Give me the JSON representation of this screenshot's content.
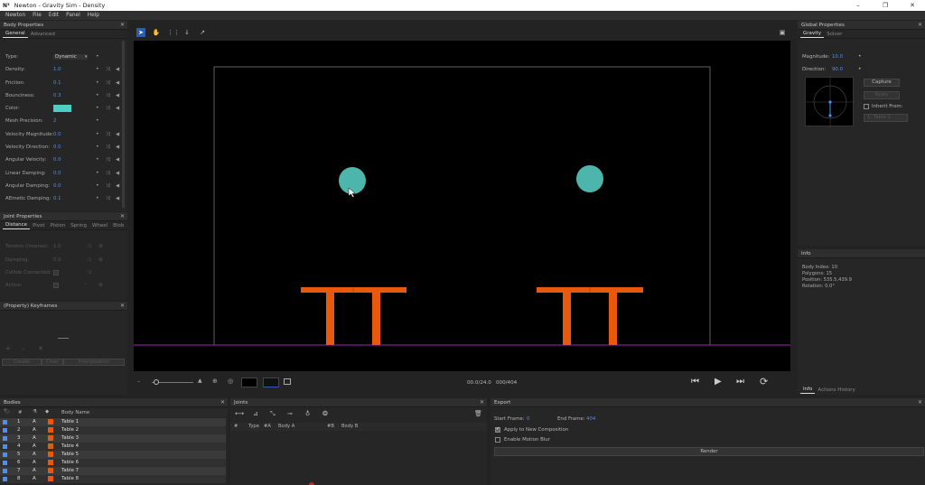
{
  "window": {
    "title": "Newton - Gravity Sim - Density",
    "logo": "N³"
  },
  "menu": [
    "Newton",
    "File",
    "Edit",
    "Panel",
    "Help"
  ],
  "body_properties": {
    "title": "Body Properties",
    "tabs": [
      "General",
      "Advanced"
    ],
    "rows": [
      {
        "label": "Type:",
        "value": "Dynamic"
      },
      {
        "label": "Density:",
        "value": "1.0"
      },
      {
        "label": "Friction:",
        "value": "0.1"
      },
      {
        "label": "Bounciness:",
        "value": "0.3"
      },
      {
        "label": "Color:",
        "value": ""
      },
      {
        "label": "Mesh Precision:",
        "value": "2"
      },
      {
        "label": "Velocity Magnitude:",
        "value": "0.0"
      },
      {
        "label": "Velocity Direction:",
        "value": "0.0"
      },
      {
        "label": "Angular Velocity:",
        "value": "0.0"
      },
      {
        "label": "Linear Damping:",
        "value": "0.0"
      },
      {
        "label": "Angular Damping:",
        "value": "0.0"
      },
      {
        "label": "AEmetic Damping:",
        "value": "0.1"
      }
    ],
    "color_swatch": "#4ecdc4"
  },
  "joint_properties": {
    "title": "Joint Properties",
    "tabs": [
      "Distance",
      "Pivot",
      "Piston",
      "Spring",
      "Wheel",
      "Blob"
    ],
    "rows": [
      {
        "label": "Tension (Inverse):",
        "value": "1.0"
      },
      {
        "label": "Damping:",
        "value": "0.0"
      },
      {
        "label": "Collide Connected:",
        "value": ""
      },
      {
        "label": "Active:",
        "value": ""
      }
    ]
  },
  "keyframes": {
    "title": "(Property) Keyframes",
    "buttons": [
      "Create",
      "Clear",
      "Interpolation"
    ]
  },
  "viewport": {
    "time": "00.0/24.0",
    "frame": "000/404",
    "ball_color": "#4db6ac",
    "table_color": "#e8590c",
    "ground_color": "#9c27b0",
    "bounds_color": "#777777"
  },
  "global_properties": {
    "title": "Global Properties",
    "tabs": [
      "Gravity",
      "Solver"
    ],
    "magnitude_label": "Magnitude:",
    "magnitude_value": "10.0",
    "direction_label": "Direction:",
    "direction_value": "90.0",
    "capture_label": "Capture",
    "apply_label": "Apply",
    "inherit_label": "Inherit From:",
    "inherit_value": "1. Table 1"
  },
  "info": {
    "title": "Info",
    "lines": [
      "Body Index: 10",
      "Polygons: 15",
      "Position: 535.5,439.9",
      "Rotation: 0.0°"
    ],
    "tabs": [
      "Info",
      "Actions History"
    ]
  },
  "bodies": {
    "title": "Bodies",
    "header": [
      "#",
      "",
      "",
      "",
      "Body Name"
    ],
    "rows": [
      {
        "idx": "1",
        "type": "A",
        "name": "Table 1"
      },
      {
        "idx": "2",
        "type": "A",
        "name": "Table 2"
      },
      {
        "idx": "3",
        "type": "A",
        "name": "Table 3"
      },
      {
        "idx": "4",
        "type": "A",
        "name": "Table 4"
      },
      {
        "idx": "5",
        "type": "A",
        "name": "Table 5"
      },
      {
        "idx": "6",
        "type": "A",
        "name": "Table 6"
      },
      {
        "idx": "7",
        "type": "A",
        "name": "Table 7"
      },
      {
        "idx": "8",
        "type": "A",
        "name": "Table 8"
      }
    ]
  },
  "joints": {
    "title": "Joints",
    "header": [
      "#",
      "Type",
      "#A",
      "Body A",
      "#B",
      "Body B"
    ]
  },
  "export": {
    "title": "Export",
    "start_label": "Start Frame:",
    "start_value": "0",
    "end_label": "End Frame:",
    "end_value": "404",
    "apply_label": "Apply to New Composition",
    "blur_label": "Enable Motion Blur",
    "render_label": "Render"
  }
}
